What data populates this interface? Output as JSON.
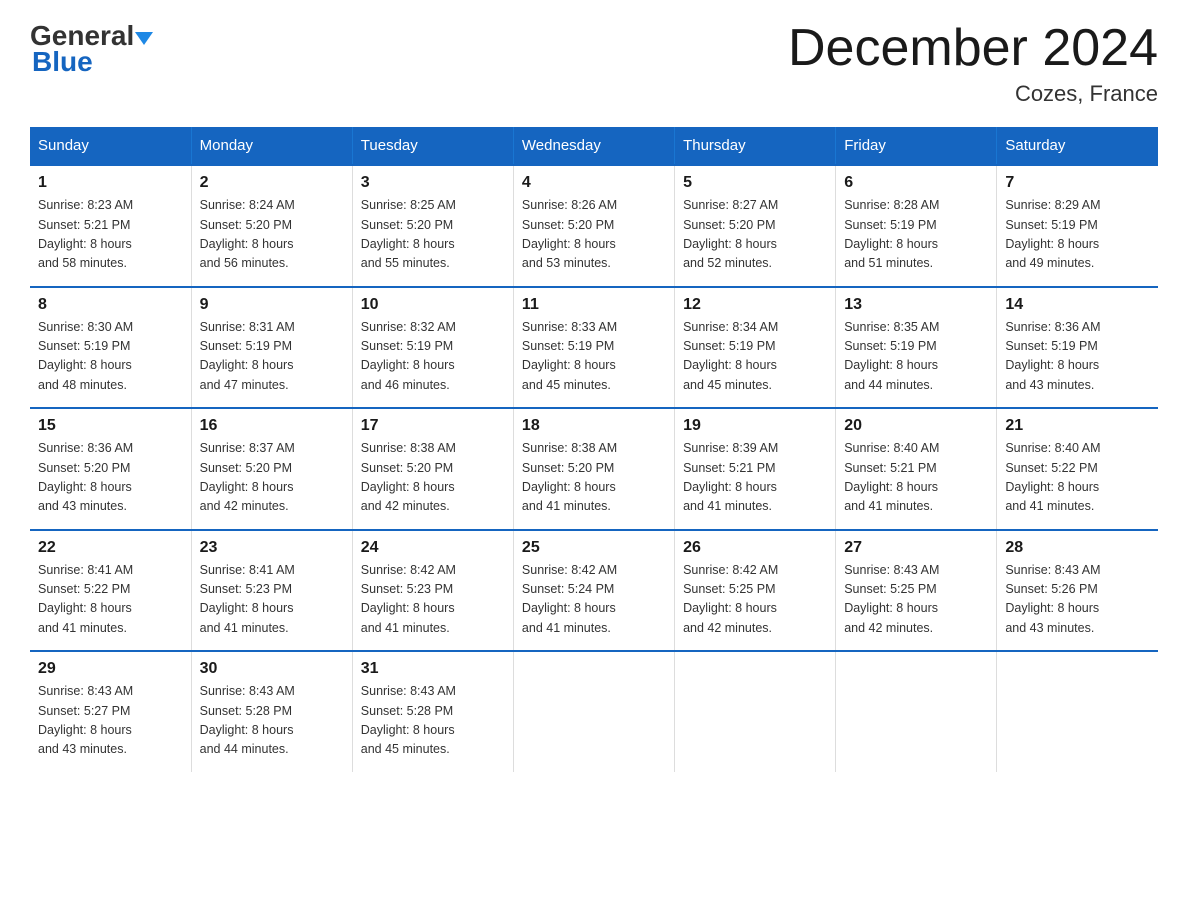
{
  "logo": {
    "line1": "General",
    "line2": "Blue"
  },
  "header": {
    "title": "December 2024",
    "location": "Cozes, France"
  },
  "weekdays": [
    "Sunday",
    "Monday",
    "Tuesday",
    "Wednesday",
    "Thursday",
    "Friday",
    "Saturday"
  ],
  "weeks": [
    [
      {
        "day": "1",
        "sunrise": "8:23 AM",
        "sunset": "5:21 PM",
        "daylight": "8 hours and 58 minutes."
      },
      {
        "day": "2",
        "sunrise": "8:24 AM",
        "sunset": "5:20 PM",
        "daylight": "8 hours and 56 minutes."
      },
      {
        "day": "3",
        "sunrise": "8:25 AM",
        "sunset": "5:20 PM",
        "daylight": "8 hours and 55 minutes."
      },
      {
        "day": "4",
        "sunrise": "8:26 AM",
        "sunset": "5:20 PM",
        "daylight": "8 hours and 53 minutes."
      },
      {
        "day": "5",
        "sunrise": "8:27 AM",
        "sunset": "5:20 PM",
        "daylight": "8 hours and 52 minutes."
      },
      {
        "day": "6",
        "sunrise": "8:28 AM",
        "sunset": "5:19 PM",
        "daylight": "8 hours and 51 minutes."
      },
      {
        "day": "7",
        "sunrise": "8:29 AM",
        "sunset": "5:19 PM",
        "daylight": "8 hours and 49 minutes."
      }
    ],
    [
      {
        "day": "8",
        "sunrise": "8:30 AM",
        "sunset": "5:19 PM",
        "daylight": "8 hours and 48 minutes."
      },
      {
        "day": "9",
        "sunrise": "8:31 AM",
        "sunset": "5:19 PM",
        "daylight": "8 hours and 47 minutes."
      },
      {
        "day": "10",
        "sunrise": "8:32 AM",
        "sunset": "5:19 PM",
        "daylight": "8 hours and 46 minutes."
      },
      {
        "day": "11",
        "sunrise": "8:33 AM",
        "sunset": "5:19 PM",
        "daylight": "8 hours and 45 minutes."
      },
      {
        "day": "12",
        "sunrise": "8:34 AM",
        "sunset": "5:19 PM",
        "daylight": "8 hours and 45 minutes."
      },
      {
        "day": "13",
        "sunrise": "8:35 AM",
        "sunset": "5:19 PM",
        "daylight": "8 hours and 44 minutes."
      },
      {
        "day": "14",
        "sunrise": "8:36 AM",
        "sunset": "5:19 PM",
        "daylight": "8 hours and 43 minutes."
      }
    ],
    [
      {
        "day": "15",
        "sunrise": "8:36 AM",
        "sunset": "5:20 PM",
        "daylight": "8 hours and 43 minutes."
      },
      {
        "day": "16",
        "sunrise": "8:37 AM",
        "sunset": "5:20 PM",
        "daylight": "8 hours and 42 minutes."
      },
      {
        "day": "17",
        "sunrise": "8:38 AM",
        "sunset": "5:20 PM",
        "daylight": "8 hours and 42 minutes."
      },
      {
        "day": "18",
        "sunrise": "8:38 AM",
        "sunset": "5:20 PM",
        "daylight": "8 hours and 41 minutes."
      },
      {
        "day": "19",
        "sunrise": "8:39 AM",
        "sunset": "5:21 PM",
        "daylight": "8 hours and 41 minutes."
      },
      {
        "day": "20",
        "sunrise": "8:40 AM",
        "sunset": "5:21 PM",
        "daylight": "8 hours and 41 minutes."
      },
      {
        "day": "21",
        "sunrise": "8:40 AM",
        "sunset": "5:22 PM",
        "daylight": "8 hours and 41 minutes."
      }
    ],
    [
      {
        "day": "22",
        "sunrise": "8:41 AM",
        "sunset": "5:22 PM",
        "daylight": "8 hours and 41 minutes."
      },
      {
        "day": "23",
        "sunrise": "8:41 AM",
        "sunset": "5:23 PM",
        "daylight": "8 hours and 41 minutes."
      },
      {
        "day": "24",
        "sunrise": "8:42 AM",
        "sunset": "5:23 PM",
        "daylight": "8 hours and 41 minutes."
      },
      {
        "day": "25",
        "sunrise": "8:42 AM",
        "sunset": "5:24 PM",
        "daylight": "8 hours and 41 minutes."
      },
      {
        "day": "26",
        "sunrise": "8:42 AM",
        "sunset": "5:25 PM",
        "daylight": "8 hours and 42 minutes."
      },
      {
        "day": "27",
        "sunrise": "8:43 AM",
        "sunset": "5:25 PM",
        "daylight": "8 hours and 42 minutes."
      },
      {
        "day": "28",
        "sunrise": "8:43 AM",
        "sunset": "5:26 PM",
        "daylight": "8 hours and 43 minutes."
      }
    ],
    [
      {
        "day": "29",
        "sunrise": "8:43 AM",
        "sunset": "5:27 PM",
        "daylight": "8 hours and 43 minutes."
      },
      {
        "day": "30",
        "sunrise": "8:43 AM",
        "sunset": "5:28 PM",
        "daylight": "8 hours and 44 minutes."
      },
      {
        "day": "31",
        "sunrise": "8:43 AM",
        "sunset": "5:28 PM",
        "daylight": "8 hours and 45 minutes."
      },
      null,
      null,
      null,
      null
    ]
  ],
  "labels": {
    "sunrise": "Sunrise:",
    "sunset": "Sunset:",
    "daylight": "Daylight:"
  }
}
